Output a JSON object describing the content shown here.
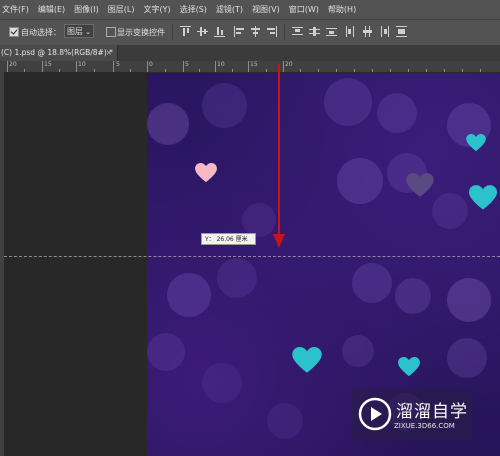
{
  "menu": [
    "文件(F)",
    "编辑(E)",
    "图像(I)",
    "图层(L)",
    "文字(Y)",
    "选择(S)",
    "滤镜(T)",
    "视图(V)",
    "窗口(W)",
    "帮助(H)"
  ],
  "options": {
    "auto_select_label": "自动选择：",
    "layer_select_value": "图层",
    "show_transform_label": "显示变换控件"
  },
  "document_tab": {
    "title": "(C) 1.psd @ 18.8%(RGB/8#) *",
    "close": "×"
  },
  "ruler": {
    "labels": [
      "20",
      "15",
      "10",
      "5",
      "0",
      "5",
      "10",
      "15",
      "20"
    ]
  },
  "tooltip": "Y： 26.06 厘米",
  "watermark": {
    "name": "溜溜自学",
    "url": "ZIXUE.3D66.COM"
  },
  "colors": {
    "canvas_bg": "#2b1663",
    "guide_arrow": "#c0161c",
    "heart_teal": "#2bc2cc",
    "heart_pink": "#f5b8c6",
    "heart_mauve": "#5a4a82"
  }
}
